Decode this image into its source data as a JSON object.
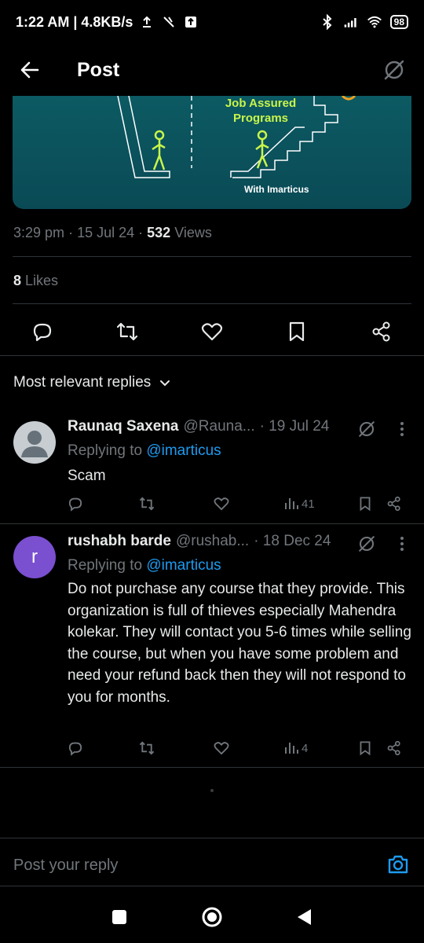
{
  "status_bar": {
    "time_speed": "1:22 AM | 4.8KB/s",
    "battery": "98"
  },
  "header": {
    "title": "Post"
  },
  "media": {
    "caption_top": "Job Assured Programs",
    "caption_bottom": "With Imarticus"
  },
  "post_meta": {
    "time": "3:29 pm",
    "date": "15 Jul 24",
    "views_count": "532",
    "views_label": "Views",
    "likes_count": "8",
    "likes_label": "Likes"
  },
  "replies_sort": {
    "label": "Most relevant replies"
  },
  "replies": [
    {
      "name": "Raunaq Saxena",
      "handle": "@Rauna...",
      "date": "· 19 Jul 24",
      "replying_label": "Replying to",
      "replying_to": "@imarticus",
      "text": "Scam",
      "views": "41"
    },
    {
      "avatar_letter": "r",
      "name": "rushabh barde",
      "handle": "@rushab...",
      "date": "· 18 Dec 24",
      "replying_label": "Replying to",
      "replying_to": "@imarticus",
      "text": "Do not purchase any course that they provide. This organization is full of thieves especially Mahendra kolekar. They will contact you 5-6 times while selling the course, but when you have some problem and need your refund back then they will not respond to you for months.",
      "views": "4"
    }
  ],
  "compose": {
    "placeholder": "Post your reply"
  },
  "colors": {
    "background": "#000000",
    "accent": "#1d9bf0",
    "muted": "#71767b",
    "avatar_purple": "#7a4fd0",
    "media_green": "#c8f54a"
  }
}
